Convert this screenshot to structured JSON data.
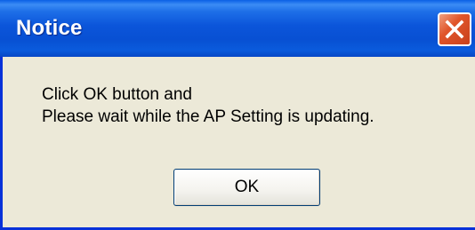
{
  "window": {
    "title": "Notice",
    "close_icon": "close-icon"
  },
  "message": {
    "line1": "Click OK button and",
    "line2": "Please wait while the AP Setting is updating."
  },
  "buttons": {
    "ok_label": "OK"
  },
  "colors": {
    "titlebar": "#0b55da",
    "frame": "#0831d9",
    "body": "#ece9d8",
    "close_button": "#e0552a"
  }
}
